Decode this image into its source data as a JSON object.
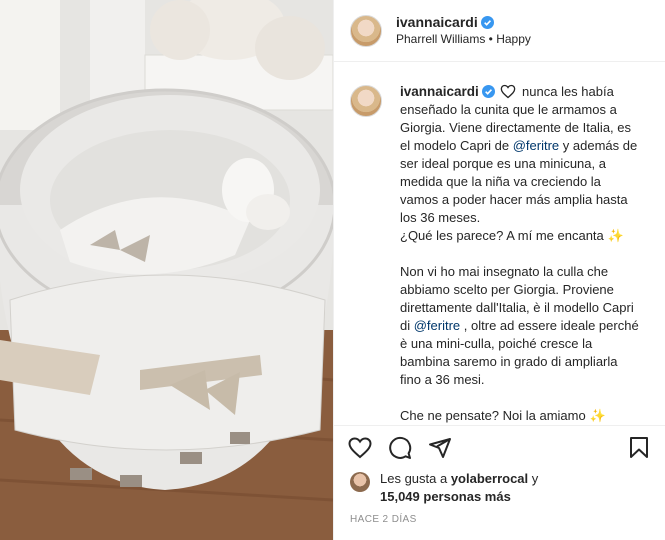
{
  "header": {
    "username": "ivannaicardi",
    "music": "Pharrell Williams • Happy"
  },
  "caption": {
    "username": "ivannaicardi",
    "es_part1": " nunca les había enseñado la cunita que le armamos a Giorgia. Viene directamente de Italia, es el modelo Capri de ",
    "es_mention": "@feritre",
    "es_part2": " y además de ser ideal porque es una minicuna, a medida que la niña va creciendo la vamos a poder hacer más amplia hasta los 36 meses.",
    "es_question": "¿Qué les parece? A mí me encanta",
    "it_part1": "Non vi ho mai insegnato la culla che abbiamo scelto per Giorgia. Proviene direttamente dall'Italia, è il modello Capri di ",
    "it_mention": "@feritre",
    "it_part2": " , oltre ad essere ideale perché è una mini-culla, poiché cresce la bambina saremo in grado di ampliarla fino a 36 mesi.",
    "it_question": "Che ne pensate? Noi la amiamo"
  },
  "likes": {
    "prefix": "Les gusta a ",
    "user": "yolaberrocal",
    "suffix": " y",
    "count": "15,049 personas más"
  },
  "timestamp": "HACE 2 DÍAS",
  "icons": {
    "like": "heart-icon",
    "comment": "comment-icon",
    "share": "share-icon",
    "save": "bookmark-icon",
    "verified": "verified-badge-icon"
  },
  "colors": {
    "verified": "#3897f0",
    "mention": "#00376b",
    "muted": "#8e8e8e"
  }
}
